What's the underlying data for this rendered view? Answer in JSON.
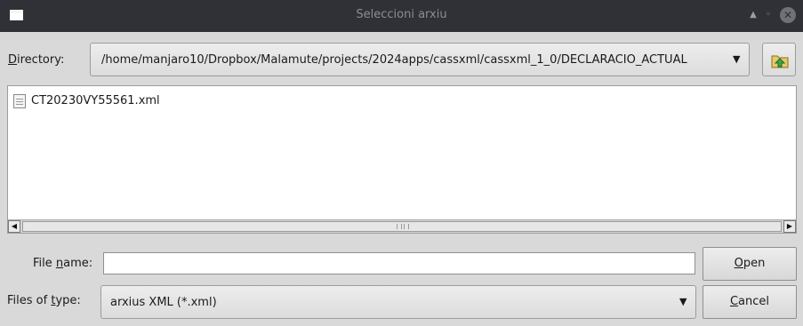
{
  "window": {
    "title": "Seleccioni arxiu",
    "icons": {
      "app": "window-icon",
      "eject": "eject-icon",
      "restore": "restore-icon",
      "close": "close-icon"
    },
    "eject_glyph": "▲",
    "restore_glyph": "◦",
    "close_glyph": "✕"
  },
  "directory": {
    "label_accel": "D",
    "label_rest": "irectory:",
    "path": "/home/manjaro10/Dropbox/Malamute/projects/2024apps/cassxml/cassxml_1_0/DECLARACIO_ACTUAL",
    "dropdown_glyph": "▼",
    "up_button_icon": "folder-up-icon"
  },
  "files": [
    {
      "name": "CT20230VY55561.xml",
      "icon": "document-icon"
    }
  ],
  "scrollbar": {
    "left_glyph": "◀",
    "right_glyph": "▶"
  },
  "filename": {
    "label_pre": "File ",
    "label_accel": "n",
    "label_rest": "ame:",
    "value": "",
    "placeholder": ""
  },
  "filetype": {
    "label_pre": "Files of ",
    "label_accel": "t",
    "label_rest": "ype:",
    "selected": "arxius XML (*.xml)",
    "dropdown_glyph": "▼"
  },
  "buttons": {
    "open_accel": "O",
    "open_rest": "pen",
    "cancel_accel": "C",
    "cancel_rest": "ancel"
  },
  "colors": {
    "titlebar": "#2f3136",
    "dialog_bg": "#d9d9d9",
    "folder_up_green": "#3aa845"
  }
}
